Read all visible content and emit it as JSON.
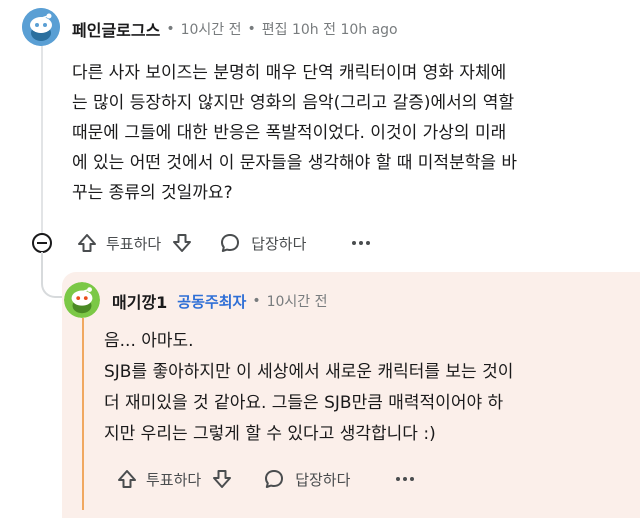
{
  "comment": {
    "username": "페인글로그스",
    "sep1": "•",
    "time": "10시간 전",
    "sep2": "•",
    "edited": "편집 10h 전 10h ago",
    "lines": [
      "다른 사자 보이즈는 분명히 매우 단역 캐릭터이며 영화 자체에",
      "는 많이 등장하지 않지만 영화의 음악(그리고 갈증)에서의 역할",
      "때문에 그들에 대한 반응은 폭발적이었다. 이것이 가상의 미래",
      "에 있는 어떤 것에서 이 문자들을 생각해야 할 때 미적분학을 바",
      "꾸는 종류의 것일까요?"
    ],
    "vote_label": "투표하다",
    "reply_label": "답장하다"
  },
  "reply": {
    "username": "매기깡1",
    "badge": "공동주최자",
    "sep": "•",
    "time": "10시간 전",
    "lines": [
      "음... 아마도.",
      "SJB를 좋아하지만 이 세상에서 새로운 캐릭터를 보는 것이",
      "더 재미있을 것 같아요. 그들은 SJB만큼 매력적이어야 하",
      "지만 우리는 그렇게 할 수 있다고 생각합니다 :)"
    ],
    "vote_label": "투표하다",
    "reply_label": "답장하다"
  },
  "colors": {
    "avatar_blue": "#5a9fd4",
    "avatar_green": "#7bc846",
    "reply_bg": "#fbefea",
    "accent_stripe": "#f0a860",
    "mod_badge": "#2f6fd6"
  },
  "icons": [
    "snoo-avatar-icon",
    "upvote-arrow-icon",
    "downvote-arrow-icon",
    "speech-bubble-icon",
    "more-dots-icon",
    "collapse-minus-icon"
  ]
}
